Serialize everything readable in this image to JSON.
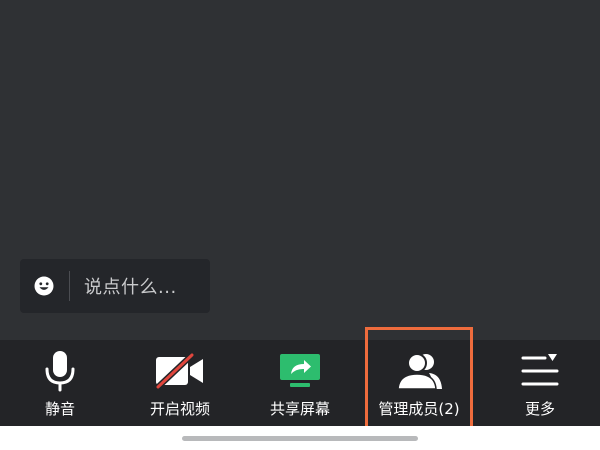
{
  "chat": {
    "placeholder": "说点什么..."
  },
  "toolbar": {
    "items": [
      {
        "label": "静音",
        "icon": "microphone-icon"
      },
      {
        "label": "开启视频",
        "icon": "video-off-icon"
      },
      {
        "label": "共享屏幕",
        "icon": "share-screen-icon"
      },
      {
        "label": "管理成员(2)",
        "icon": "members-icon"
      },
      {
        "label": "更多",
        "icon": "more-menu-icon"
      }
    ]
  },
  "colors": {
    "stage_bg": "#2f3134",
    "toolbar_bg": "#232427",
    "share_green": "#2dbd6e",
    "video_off_red": "#e0463d",
    "highlight_orange": "#ee6c3d"
  }
}
